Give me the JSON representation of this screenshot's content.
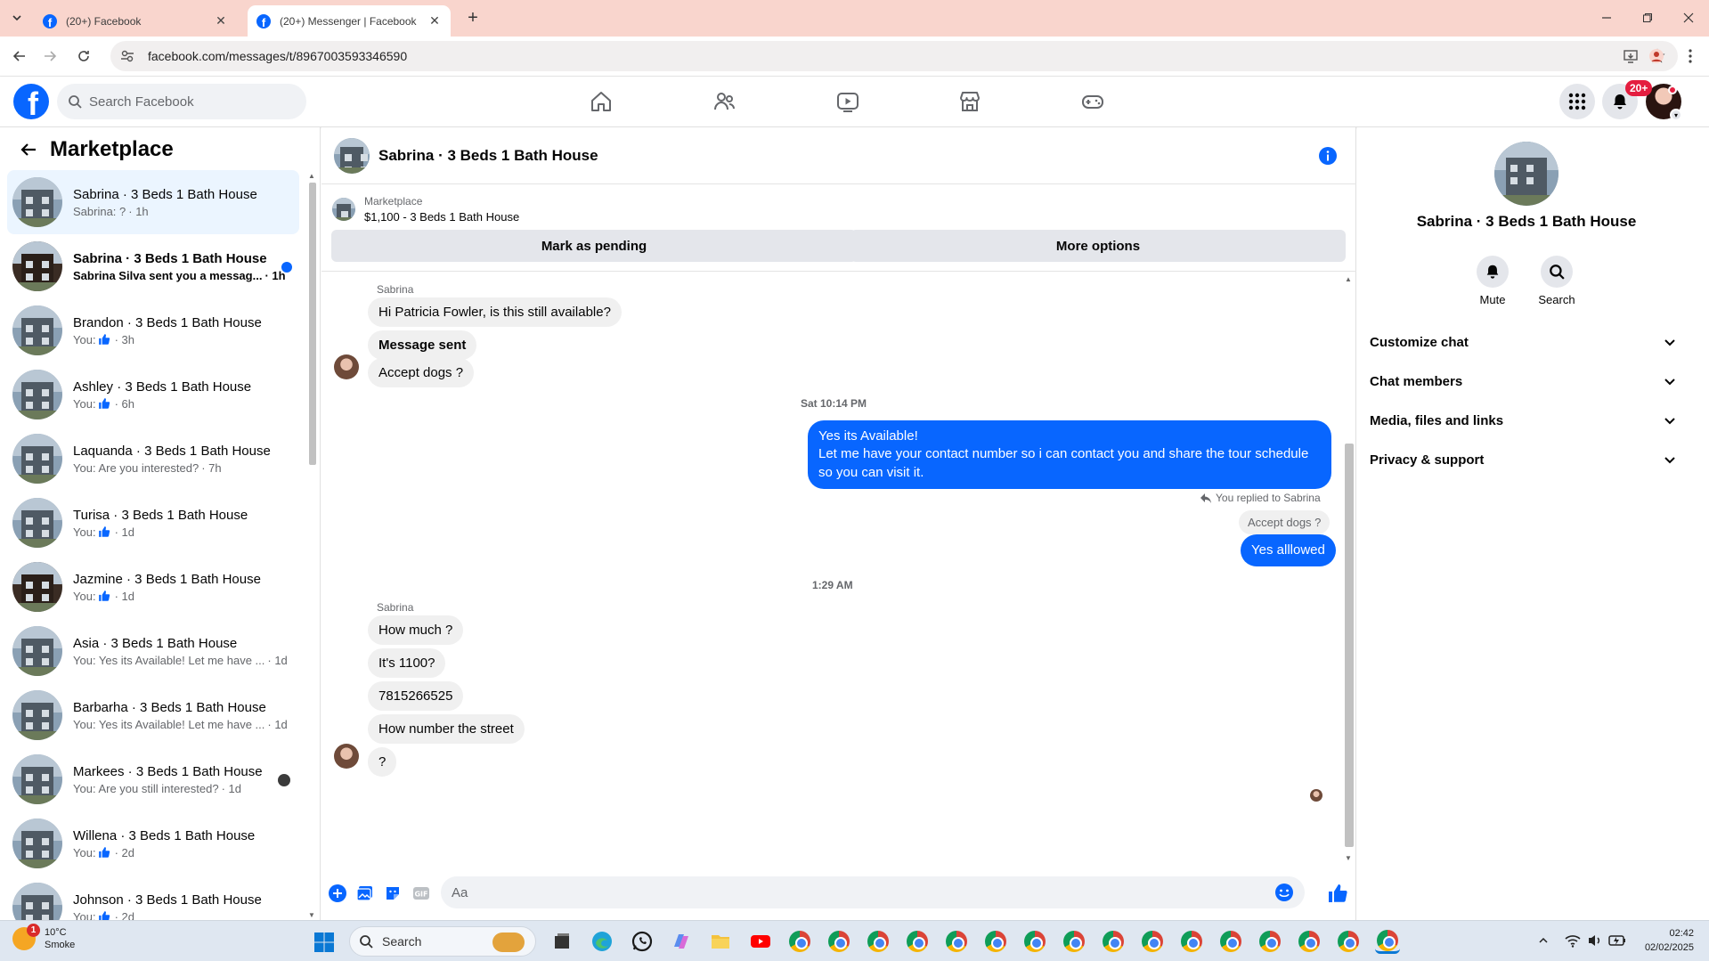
{
  "browser": {
    "tabs": [
      {
        "title": "(20+) Facebook",
        "active": false
      },
      {
        "title": "(20+) Messenger | Facebook",
        "active": true
      }
    ],
    "url": "facebook.com/messages/t/8967003593346590"
  },
  "header": {
    "search_placeholder": "Search Facebook",
    "notification_badge": "20+"
  },
  "left": {
    "title": "Marketplace",
    "conversations": [
      {
        "name": "Sabrina · 3 Beds 1 Bath House",
        "preview": "Sabrina: ?",
        "time": "· 1h",
        "selected": true
      },
      {
        "name": "Sabrina · 3 Beds 1 Bath House",
        "preview": "Sabrina Silva sent you a messag...",
        "time": "· 1h",
        "unread": true
      },
      {
        "name": "Brandon · 3 Beds 1 Bath House",
        "preview": "You:",
        "time": "· 3h",
        "like": true
      },
      {
        "name": "Ashley · 3 Beds 1 Bath House",
        "preview": "You:",
        "time": "· 6h",
        "like": true
      },
      {
        "name": "Laquanda · 3 Beds 1 Bath House",
        "preview": "You: Are you interested?",
        "time": "· 7h"
      },
      {
        "name": "Turisa · 3 Beds 1 Bath House",
        "preview": "You:",
        "time": "· 1d",
        "like": true
      },
      {
        "name": "Jazmine · 3 Beds 1 Bath House",
        "preview": "You:",
        "time": "· 1d",
        "like": true
      },
      {
        "name": "Asia · 3 Beds 1 Bath House",
        "preview": "You: Yes its Available! Let me have ...",
        "time": "· 1d"
      },
      {
        "name": "Barbarha · 3 Beds 1 Bath House",
        "preview": "You: Yes its Available! Let me have ...",
        "time": "· 1d"
      },
      {
        "name": "Markees · 3 Beds 1 Bath House",
        "preview": "You: Are you still interested?",
        "time": "· 1d"
      },
      {
        "name": "Willena · 3 Beds 1 Bath House",
        "preview": "You:",
        "time": "· 2d",
        "like": true
      },
      {
        "name": "Johnson · 3 Beds 1 Bath House",
        "preview": "You:",
        "time": "· 2d",
        "like": true
      }
    ]
  },
  "chat": {
    "title": "Sabrina · 3 Beds 1 Bath House",
    "marketplace_label": "Marketplace",
    "listing": "$1,100 - 3 Beds 1 Bath House",
    "mark_pending_label": "Mark as pending",
    "more_options_label": "More options",
    "sender_name": "Sabrina",
    "msg_in_1": "Hi Patricia Fowler, is this still available?",
    "msg_in_2": "Message sent",
    "msg_in_3": "Accept dogs ?",
    "timestamp_1": "Sat 10:14 PM",
    "msg_out_1_line1": "Yes its Available!",
    "msg_out_1_line2": "Let me have your contact number so i can contact you and share the tour schedule so you can visit it.",
    "reply_note": "You replied to Sabrina",
    "quoted": "Accept dogs ?",
    "msg_out_2": "Yes alllowed",
    "timestamp_2": "1:29 AM",
    "msg_in_4": "How much ?",
    "msg_in_5": "It's 1100?",
    "msg_in_6": "7815266525",
    "msg_in_7": "How number the street",
    "msg_in_8": "?",
    "composer_placeholder": "Aa"
  },
  "right": {
    "name": "Sabrina · 3 Beds 1 Bath House",
    "mute_label": "Mute",
    "search_label": "Search",
    "sections": [
      "Customize chat",
      "Chat members",
      "Media, files and links",
      "Privacy & support"
    ]
  },
  "taskbar": {
    "weather_temp": "10°C",
    "weather_desc": "Smoke",
    "weather_badge": "1",
    "search_label": "Search",
    "time": "02:42",
    "date": "02/02/2025"
  },
  "colors": {
    "accent": "#0866ff",
    "tabbar": "#f9d5cd",
    "selected_row": "#ebf5ff",
    "bubble_in": "#f0f0f0"
  }
}
